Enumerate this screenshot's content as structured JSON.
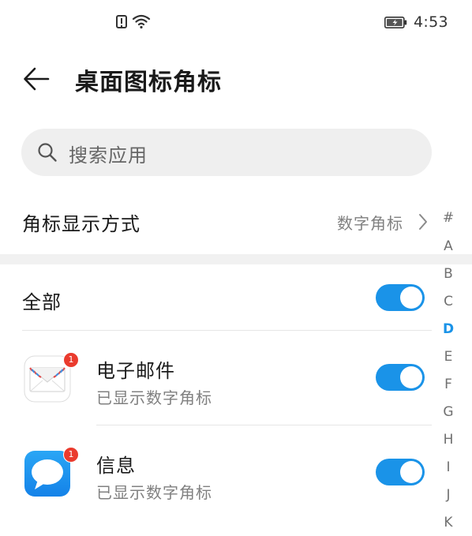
{
  "status_bar": {
    "time": "4:53",
    "icons": [
      "alert-icon",
      "wifi-icon",
      "battery-charging-icon"
    ]
  },
  "header": {
    "title": "桌面图标角标",
    "back_icon": "arrow-left-icon"
  },
  "search": {
    "placeholder": "搜索应用",
    "icon": "search-icon"
  },
  "badge_mode": {
    "label": "角标显示方式",
    "value": "数字角标"
  },
  "all_toggle": {
    "label": "全部",
    "checked": true
  },
  "apps": [
    {
      "name": "电子邮件",
      "status": "已显示数字角标",
      "badge": "1",
      "icon": "email-app-icon",
      "checked": true
    },
    {
      "name": "信息",
      "status": "已显示数字角标",
      "badge": "1",
      "icon": "messages-app-icon",
      "checked": true
    }
  ],
  "index": {
    "letters": [
      "#",
      "A",
      "B",
      "C",
      "D",
      "E",
      "F",
      "G",
      "H",
      "I",
      "J",
      "K"
    ],
    "active": "D"
  },
  "colors": {
    "accent": "#1a93e8",
    "badge": "#ea3b2e",
    "secondary_text": "#808080",
    "search_bg": "#efefef"
  }
}
